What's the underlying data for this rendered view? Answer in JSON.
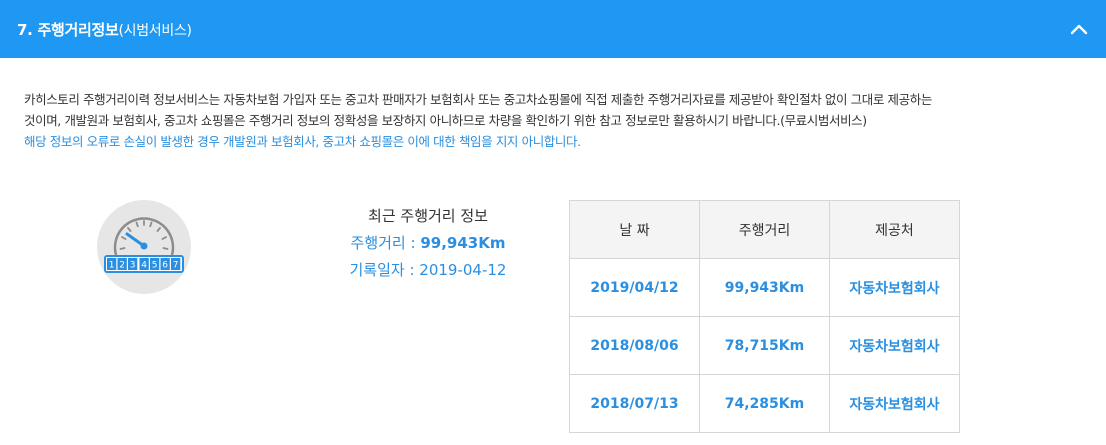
{
  "header": {
    "title": "7. 주행거리정보",
    "title_sub": "(시범서비스)"
  },
  "intro": {
    "line1": "카히스토리 주행거리이력 정보서비스는 자동차보험 가입자 또는 중고차 판매자가 보험회사 또는 중고차쇼핑몰에 직접 제출한 주행거리자료를 제공받아 확인절차 없이 그대로 제공하는",
    "line2": "것이며, 개발원과 보험회사, 중고차 쇼핑몰은 주행거리 정보의 정확성을 보장하지 아니하므로 차량을 확인하기 위한 참고 정보로만 활용하시기 바랍니다.(무료시범서비스)",
    "notice": "해당 정보의 오류로 손실이 발생한 경우 개발원과 보험회사, 중고차 쇼핑몰은 이에 대한 책임을 지지 아니합니다."
  },
  "odometer_digits": [
    "1",
    "2",
    "3",
    "4",
    "5",
    "6",
    "7"
  ],
  "latest": {
    "title": "최근 주행거리 정보",
    "mileage_label": "주행거리 : ",
    "mileage_value": "99,943Km",
    "date_label": "기록일자 : ",
    "date_value": "2019-04-12"
  },
  "table": {
    "headers": [
      "날 짜",
      "주행거리",
      "제공처"
    ],
    "rows": [
      [
        "2019/04/12",
        "99,943Km",
        "자동차보험회사"
      ],
      [
        "2018/08/06",
        "78,715Km",
        "자동차보험회사"
      ],
      [
        "2018/07/13",
        "74,285Km",
        "자동차보험회사"
      ]
    ]
  },
  "icons": {
    "collapse": "chevron-up-icon",
    "gauge": "odometer-gauge-icon"
  },
  "colors": {
    "header_bg": "#1e98f2",
    "accent": "#2a8fe0",
    "table_header_bg": "#f4f4f4"
  }
}
